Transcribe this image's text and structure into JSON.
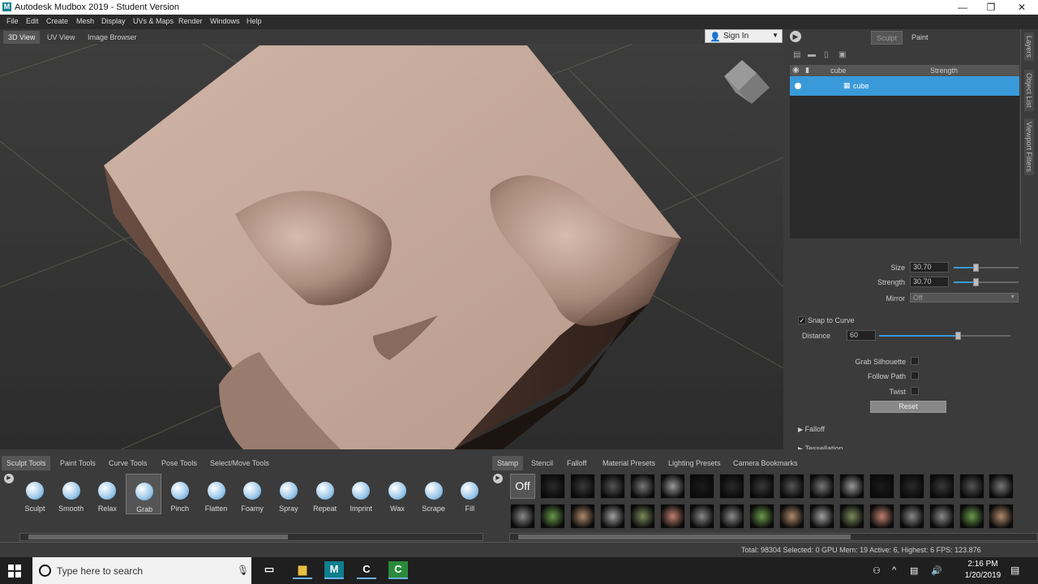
{
  "window": {
    "app_icon": "M",
    "title": "Autodesk Mudbox 2019 - Student Version",
    "minimize": "—",
    "maximize": "❐",
    "close": "✕"
  },
  "menu": [
    "File",
    "Edit",
    "Create",
    "Mesh",
    "Display",
    "UVs & Maps",
    "Render",
    "Windows",
    "Help"
  ],
  "view_tabs": [
    "3D View",
    "UV View",
    "Image Browser"
  ],
  "sign_in": {
    "label": "Sign In"
  },
  "right_panel": {
    "mode_tabs": [
      "Sculpt",
      "Paint"
    ],
    "layer_header": {
      "name": "cube",
      "strength": "Strength"
    },
    "layer_row": {
      "name": "cube"
    },
    "side_tabs": [
      "Layers",
      "Object List",
      "Viewport Filters"
    ]
  },
  "properties": {
    "size": {
      "label": "Size",
      "value": "30.70",
      "level": 0.34
    },
    "strength": {
      "label": "Strength",
      "value": "30.70",
      "level": 0.34
    },
    "mirror": {
      "label": "Mirror",
      "value": "Off"
    },
    "snap_to_curve": {
      "label": "Snap to Curve",
      "checked": "✓"
    },
    "distance": {
      "label": "Distance",
      "value": "60",
      "level": 0.6
    },
    "grab_silhouette": {
      "label": "Grab Silhouette"
    },
    "follow_path": {
      "label": "Follow Path"
    },
    "twist": {
      "label": "Twist"
    },
    "reset": "Reset",
    "falloff": "Falloff",
    "tessellation": "Tessellation"
  },
  "tool_tabs": [
    "Sculpt Tools",
    "Paint Tools",
    "Curve Tools",
    "Pose Tools",
    "Select/Move Tools"
  ],
  "tools": [
    "Sculpt",
    "Smooth",
    "Relax",
    "Grab",
    "Pinch",
    "Flatten",
    "Foamy",
    "Spray",
    "Repeat",
    "Imprint",
    "Wax",
    "Scrape",
    "Fill"
  ],
  "active_tool": "Grab",
  "stamp_tabs": [
    "Stamp",
    "Stencil",
    "Falloff",
    "Material Presets",
    "Lighting Presets",
    "Camera Bookmarks"
  ],
  "stamp_off": "Off",
  "status": "Total: 98304  Selected: 0 GPU Mem: 19  Active: 6, Highest: 6  FPS: 123.876",
  "taskbar": {
    "search_placeholder": "Type here to search",
    "time": "2:16 PM",
    "date": "1/20/2019"
  },
  "colors": {
    "accent": "#3a9ad9",
    "mesh": "#c4a89a"
  }
}
